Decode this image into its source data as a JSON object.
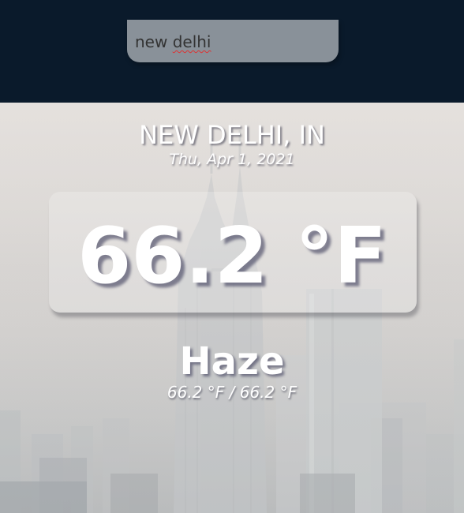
{
  "search": {
    "value_prefix": "new ",
    "value_misspelled": "delhi",
    "placeholder": ""
  },
  "weather": {
    "location": "NEW DELHI, IN",
    "date": "Thu, Apr 1, 2021",
    "temperature": "66.2 °F",
    "condition": "Haze",
    "high_low": "66.2 °F / 66.2 °F"
  },
  "theme": {
    "header_background": "#0a1a2b",
    "text_color": "#ffffff"
  },
  "background": {
    "scene": "hazy city skyline"
  }
}
